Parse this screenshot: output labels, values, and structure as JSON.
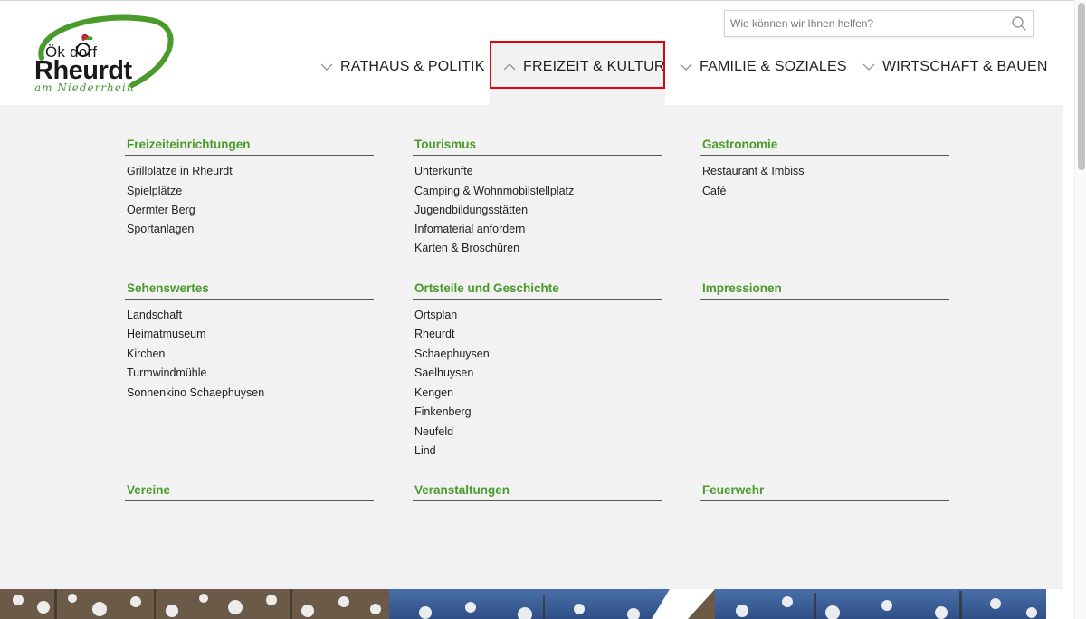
{
  "logo": {
    "small_text": "Ök   dorf",
    "big_text": "Rheurdt",
    "script_text": "am Niederrhein"
  },
  "search": {
    "placeholder": "Wie können wir Ihnen helfen?"
  },
  "nav": {
    "items": [
      {
        "label": "RATHAUS & POLITIK"
      },
      {
        "label": "FREIZEIT & KULTUR"
      },
      {
        "label": "FAMILIE & SOZIALES"
      },
      {
        "label": "WIRTSCHAFT & BAUEN"
      }
    ]
  },
  "menu": {
    "sections": [
      {
        "title": "Freizeiteinrichtungen",
        "links": [
          "Grillplätze in Rheurdt",
          "Spielplätze",
          "Oermter Berg",
          "Sportanlagen"
        ]
      },
      {
        "title": "Tourismus",
        "links": [
          "Unterkünfte",
          "Camping & Wohnmobilstellplatz",
          "Jugendbildungsstätten",
          "Infomaterial anfordern",
          "Karten & Broschüren"
        ]
      },
      {
        "title": "Gastronomie",
        "links": [
          "Restaurant & Imbiss",
          "Café"
        ]
      },
      {
        "title": "Sehenswertes",
        "links": [
          "Landschaft",
          "Heimatmuseum",
          "Kirchen",
          "Turmwindmühle",
          "Sonnenkino Schaephuysen"
        ]
      },
      {
        "title": "Ortsteile und Geschichte",
        "links": [
          "Ortsplan",
          "Rheurdt",
          "Schaephuysen",
          "Saelhuysen",
          "Kengen",
          "Finkenberg",
          "Neufeld",
          "Lind"
        ]
      },
      {
        "title": "Impressionen",
        "links": []
      },
      {
        "title": "Vereine",
        "links": []
      },
      {
        "title": "Veranstaltungen",
        "links": []
      },
      {
        "title": "Feuerwehr",
        "links": []
      }
    ]
  },
  "colors": {
    "accent_green": "#4a9a2c",
    "highlight_red": "#e3000f",
    "panel_bg": "#f2f2f2"
  }
}
